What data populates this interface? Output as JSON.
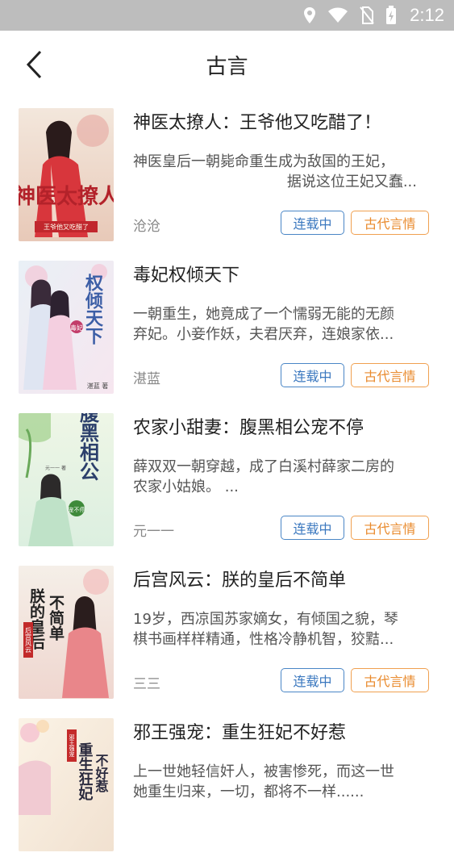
{
  "status_bar": {
    "time": "2:12"
  },
  "header": {
    "title": "古言"
  },
  "books": [
    {
      "title": "神医太撩人：王爷他又吃醋了！",
      "description_line1": "神医皇后一朝毙命重生成为敌国的王妃，",
      "description_line2": "据说这位王妃又蠢...",
      "author": "沧沧",
      "status": "连载中",
      "genre": "古代言情",
      "cover_text_main": "神医太撩人",
      "cover_text_sub": "王爷他又吃醋了"
    },
    {
      "title": "毒妃权倾天下",
      "description_line1": "一朝重生，她竟成了一个懦弱无能的无颜",
      "description_line2": "弃妃。小妾作妖，夫君厌弃，连娘家依...",
      "author": "湛蓝",
      "status": "连载中",
      "genre": "古代言情",
      "cover_text_main": "权倾天下",
      "cover_text_sub": "毒妃",
      "cover_author": "湛蓝 著"
    },
    {
      "title": "农家小甜妻：腹黑相公宠不停",
      "description_line1": "薛双双一朝穿越，成了白溪村薛家二房的",
      "description_line2": "农家小姑娘。 ...",
      "author": "元一一",
      "status": "连载中",
      "genre": "古代言情",
      "cover_text_main": "腹黑相公",
      "cover_text_sub": "宠不停",
      "cover_author": "元一一 著"
    },
    {
      "title": "后宫风云：朕的皇后不简单",
      "description_line1": "19岁，西凉国苏家嫡女，有倾国之貌，琴",
      "description_line2": "棋书画样样精通，性格冷静机智，狡黠...",
      "author": "三三",
      "status": "连载中",
      "genre": "古代言情",
      "cover_text_main": "朕的皇后",
      "cover_text_main2": "不简单",
      "cover_text_sub": "后宫风云"
    },
    {
      "title": "邪王强宠：重生狂妃不好惹",
      "description_line1": "上一世她轻信奸人，被害惨死，而这一世",
      "description_line2": "她重生归来，一切，都将不一样......",
      "author": "",
      "status": "",
      "genre": "",
      "cover_text_main": "重生狂妃",
      "cover_text_main2": "不好惹",
      "cover_text_sub": "邪王强宠"
    }
  ],
  "colors": {
    "status_bar_bg": "#bdbdbd",
    "tag_blue": "#3b78bf",
    "tag_orange": "#e98a2c"
  }
}
